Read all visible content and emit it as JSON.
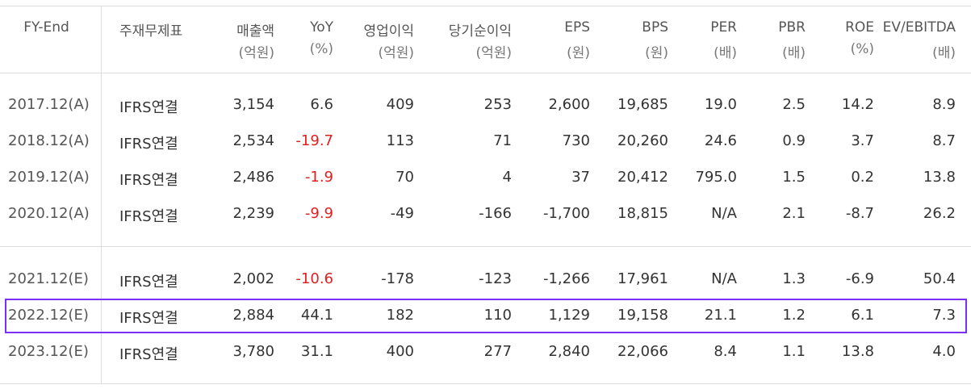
{
  "headers": [
    {
      "line1": "FY-End",
      "line2": ""
    },
    {
      "line1": "주재무제표",
      "line2": ""
    },
    {
      "line1": "매출액",
      "line2": "(억원)"
    },
    {
      "line1": "YoY",
      "line2": "(%)"
    },
    {
      "line1": "영업이익",
      "line2": "(억원)"
    },
    {
      "line1": "당기순이익",
      "line2": "(억원)"
    },
    {
      "line1": "EPS",
      "line2": "(원)"
    },
    {
      "line1": "BPS",
      "line2": "(원)"
    },
    {
      "line1": "PER",
      "line2": "(배)"
    },
    {
      "line1": "PBR",
      "line2": "(배)"
    },
    {
      "line1": "ROE",
      "line2": "(%)"
    },
    {
      "line1": "EV/EBITDA",
      "line2": "(배)"
    }
  ],
  "rows": [
    [
      "2017.12(A)",
      "IFRS연결",
      "3,154",
      "6.6",
      "409",
      "253",
      "2,600",
      "19,685",
      "19.0",
      "2.5",
      "14.2",
      "8.9"
    ],
    [
      "2018.12(A)",
      "IFRS연결",
      "2,534",
      "-19.7",
      "113",
      "71",
      "730",
      "20,260",
      "24.6",
      "0.9",
      "3.7",
      "8.7"
    ],
    [
      "2019.12(A)",
      "IFRS연결",
      "2,486",
      "-1.9",
      "70",
      "4",
      "37",
      "20,412",
      "795.0",
      "1.5",
      "0.2",
      "13.8"
    ],
    [
      "2020.12(A)",
      "IFRS연결",
      "2,239",
      "-9.9",
      "-49",
      "-166",
      "-1,700",
      "18,815",
      "N/A",
      "2.1",
      "-8.7",
      "26.2"
    ],
    [
      "2021.12(E)",
      "IFRS연결",
      "2,002",
      "-10.6",
      "-178",
      "-123",
      "-1,266",
      "17,961",
      "N/A",
      "1.3",
      "-6.9",
      "50.4"
    ],
    [
      "2022.12(E)",
      "IFRS연결",
      "2,884",
      "44.1",
      "182",
      "110",
      "1,129",
      "19,158",
      "21.1",
      "1.2",
      "6.1",
      "7.3"
    ],
    [
      "2023.12(E)",
      "IFRS연결",
      "3,780",
      "31.1",
      "400",
      "277",
      "2,840",
      "22,066",
      "8.4",
      "1.1",
      "13.8",
      "4.0"
    ]
  ],
  "highlighted_row": "2022.12(E)",
  "colors": {
    "negative_yoy": "#e02020",
    "highlight_border": "#7b2ff7",
    "grid": "#dddddd"
  }
}
